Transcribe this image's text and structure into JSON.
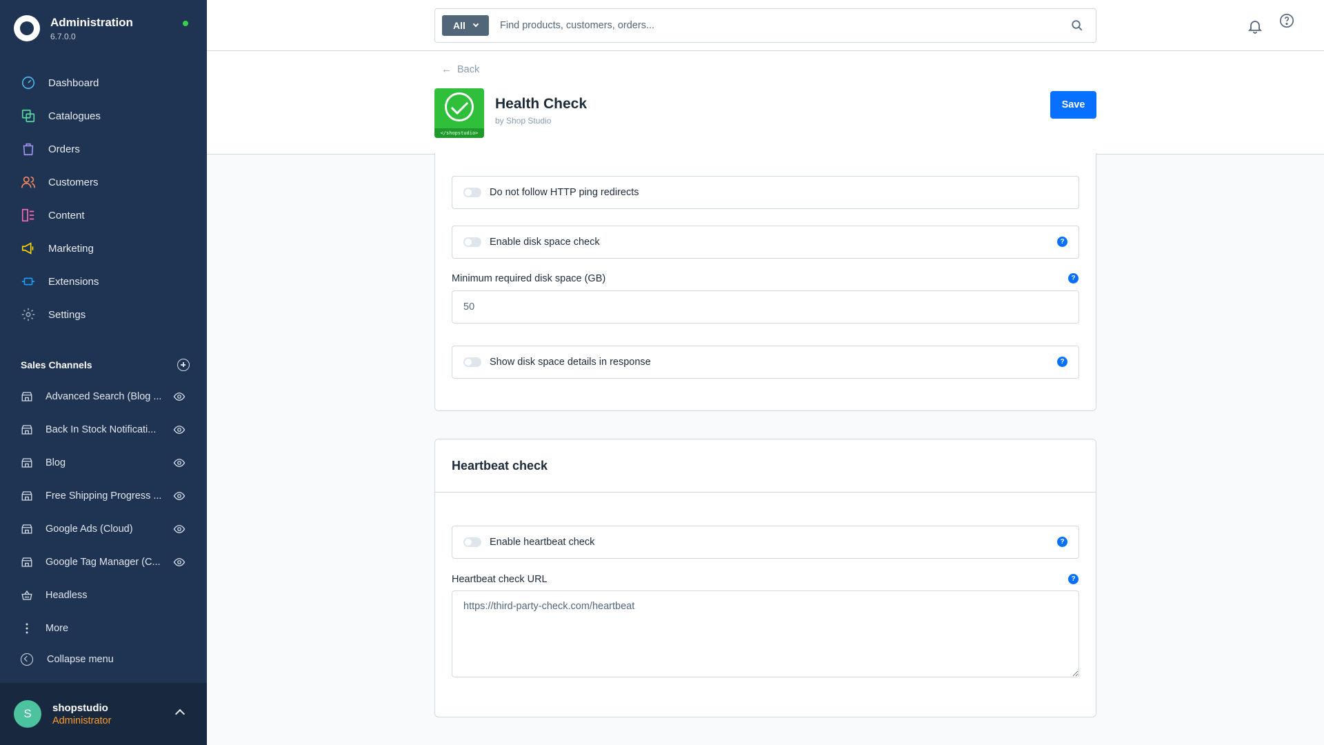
{
  "brand": {
    "title": "Administration",
    "version": "6.7.0.0"
  },
  "nav": [
    {
      "label": "Dashboard",
      "icon": "dashboard-icon",
      "color": "#4fb6e8"
    },
    {
      "label": "Catalogues",
      "icon": "catalogues-icon",
      "color": "#57d9a3"
    },
    {
      "label": "Orders",
      "icon": "orders-icon",
      "color": "#a092f0"
    },
    {
      "label": "Customers",
      "icon": "customers-icon",
      "color": "#f88962"
    },
    {
      "label": "Content",
      "icon": "content-icon",
      "color": "#ff68b4"
    },
    {
      "label": "Marketing",
      "icon": "marketing-icon",
      "color": "#ffd700"
    },
    {
      "label": "Extensions",
      "icon": "extensions-icon",
      "color": "#189eff"
    },
    {
      "label": "Settings",
      "icon": "settings-icon",
      "color": "#9aa8b5"
    }
  ],
  "sales_channels": {
    "title": "Sales Channels",
    "items": [
      {
        "label": "Advanced Search (Blog ..."
      },
      {
        "label": "Back In Stock Notificati..."
      },
      {
        "label": "Blog"
      },
      {
        "label": "Free Shipping Progress ..."
      },
      {
        "label": "Google Ads (Cloud)"
      },
      {
        "label": "Google Tag Manager (C..."
      },
      {
        "label": "Headless"
      }
    ],
    "more_label": "More"
  },
  "collapse_label": "Collapse menu",
  "user": {
    "initial": "S",
    "name": "shopstudio",
    "role": "Administrator"
  },
  "search": {
    "filter_label": "All",
    "placeholder": "Find products, customers, orders..."
  },
  "page": {
    "back_label": "Back",
    "title": "Health Check",
    "vendor": "by Shop Studio",
    "logo_caption": "</shopstudio>",
    "save_label": "Save"
  },
  "card1": {
    "switch_follow": "Do not follow HTTP ping redirects",
    "switch_disk": "Enable disk space check",
    "min_disk_label": "Minimum required disk space (GB)",
    "min_disk_value": "50",
    "switch_details": "Show disk space details in response"
  },
  "card2": {
    "title": "Heartbeat check",
    "switch_heartbeat": "Enable heartbeat check",
    "url_label": "Heartbeat check URL",
    "url_placeholder": "https://third-party-check.com/heartbeat"
  },
  "colors": {
    "accent": "#0870ff",
    "sidebar": "#1f3352",
    "role": "#ff9a2e"
  }
}
